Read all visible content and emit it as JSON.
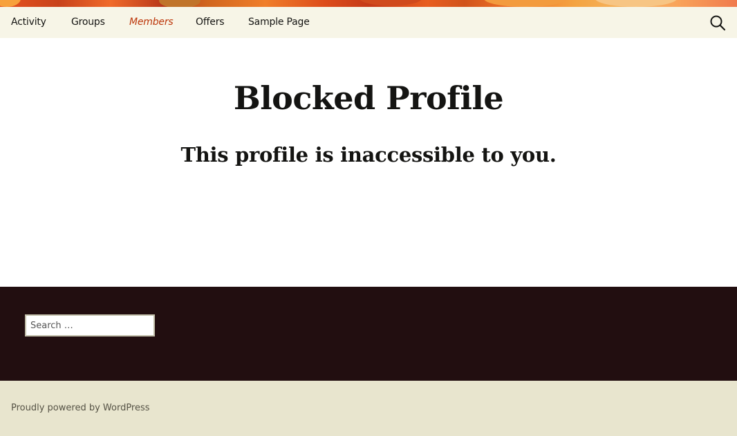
{
  "nav": {
    "items": [
      {
        "label": "Activity"
      },
      {
        "label": "Groups"
      },
      {
        "label": "Members",
        "active": true
      },
      {
        "label": "Offers"
      },
      {
        "label": "Sample Page"
      }
    ],
    "search_icon": "search-icon"
  },
  "content": {
    "title": "Blocked Profile",
    "subtitle": "This profile is inaccessible to you."
  },
  "footer": {
    "search_placeholder": "Search …",
    "powered_by": "Proudly powered by WordPress"
  },
  "colors": {
    "nav_bg": "#f7f5e7",
    "active_link": "#bc360a",
    "footer_widgets_bg": "#220e10",
    "site_info_bg": "#e8e5ce"
  }
}
